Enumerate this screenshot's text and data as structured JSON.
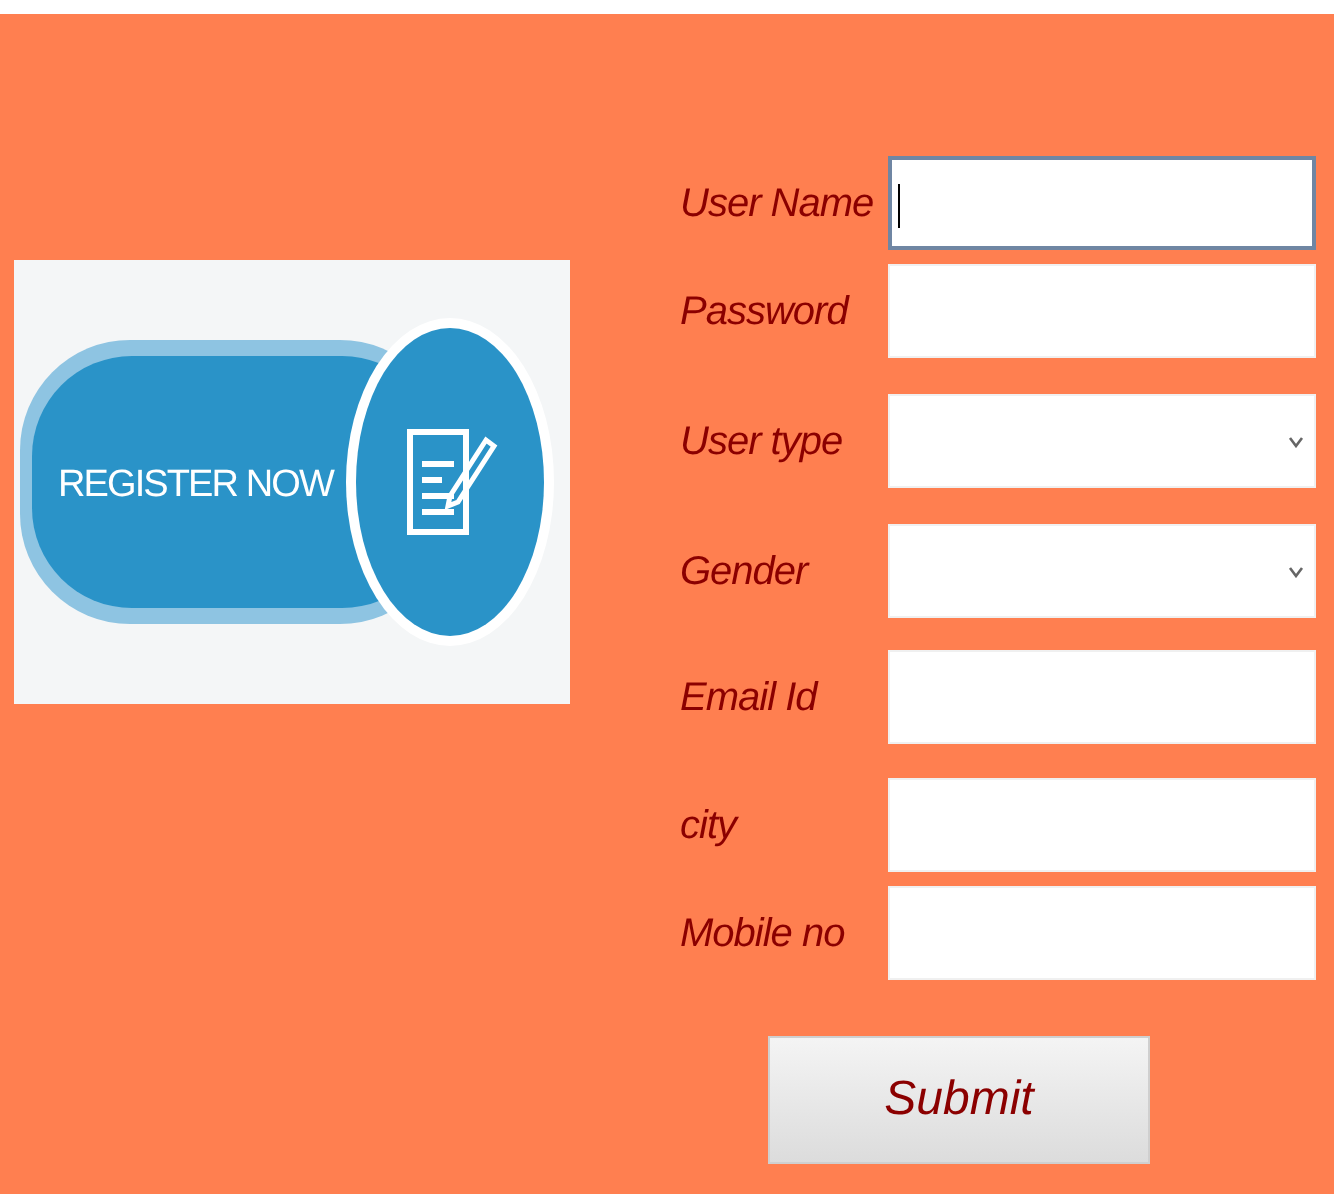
{
  "banner": {
    "label": "REGISTER NOW"
  },
  "form": {
    "fields": [
      {
        "label": "User Name",
        "kind": "text",
        "focused": true
      },
      {
        "label": "Password",
        "kind": "text",
        "focused": false
      },
      {
        "label": "User type",
        "kind": "select",
        "focused": false
      },
      {
        "label": "Gender",
        "kind": "select",
        "focused": false
      },
      {
        "label": "Email Id",
        "kind": "text",
        "focused": false
      },
      {
        "label": "city",
        "kind": "text",
        "focused": false
      },
      {
        "label": "Mobile no",
        "kind": "text",
        "focused": false
      }
    ],
    "submit": "Submit"
  }
}
